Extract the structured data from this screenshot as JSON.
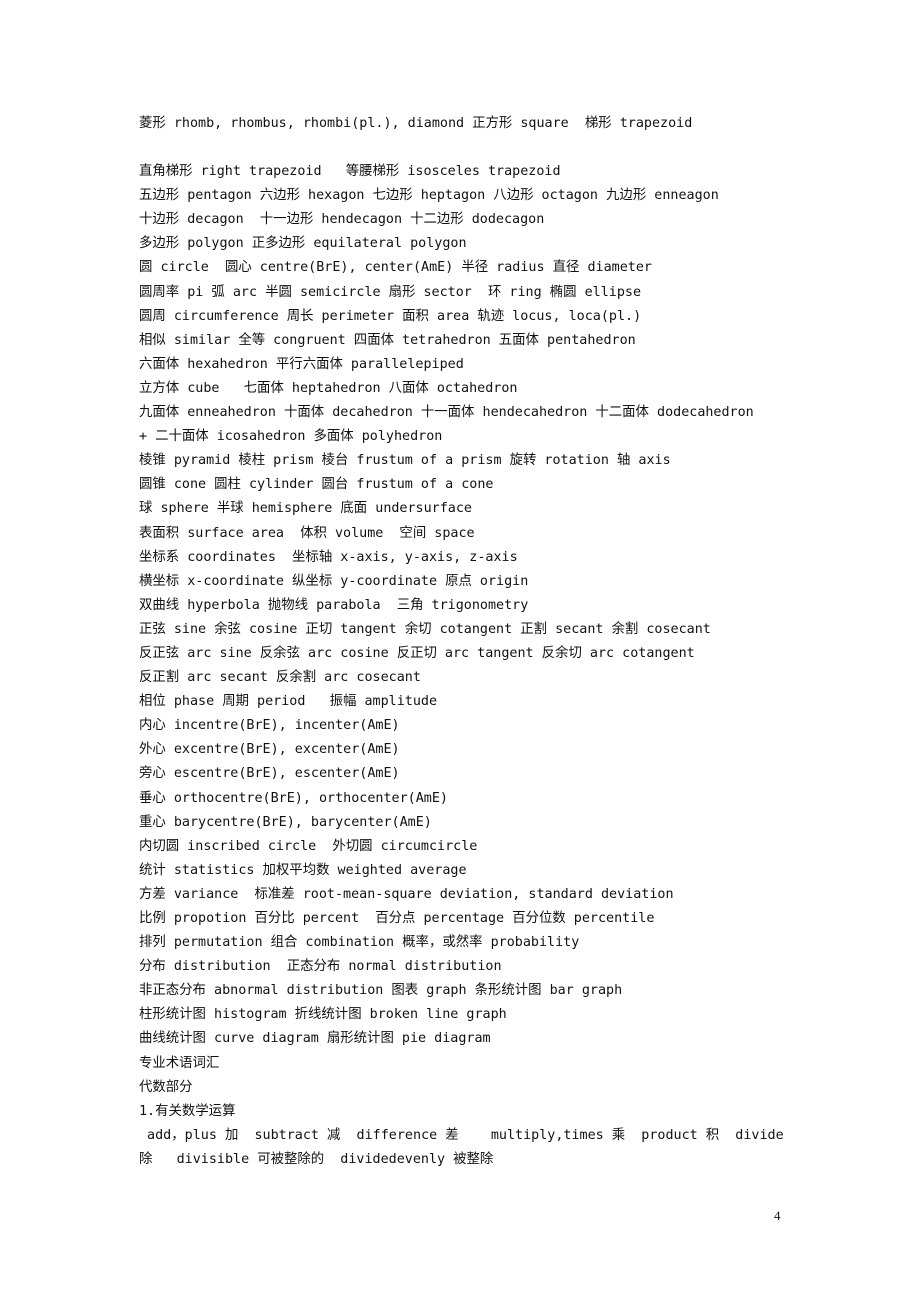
{
  "document": {
    "lines": [
      "菱形 rhomb, rhombus, rhombi(pl.), diamond 正方形 square  梯形 trapezoid",
      "",
      "直角梯形 right trapezoid   等腰梯形 isosceles trapezoid",
      "五边形 pentagon 六边形 hexagon 七边形 heptagon 八边形 octagon 九边形 enneagon",
      "十边形 decagon  十一边形 hendecagon 十二边形 dodecagon",
      "多边形 polygon 正多边形 equilateral polygon",
      "圆 circle  圆心 centre(BrE), center(AmE) 半径 radius 直径 diameter",
      "圆周率 pi 弧 arc 半圆 semicircle 扇形 sector  环 ring 椭圆 ellipse",
      "圆周 circumference 周长 perimeter 面积 area 轨迹 locus, loca(pl.)",
      "相似 similar 全等 congruent 四面体 tetrahedron 五面体 pentahedron",
      "六面体 hexahedron 平行六面体 parallelepiped",
      "立方体 cube   七面体 heptahedron 八面体 octahedron",
      "九面体 enneahedron 十面体 decahedron 十一面体 hendecahedron 十二面体 dodecahedron",
      "+ 二十面体 icosahedron 多面体 polyhedron",
      "棱锥 pyramid 棱柱 prism 棱台 frustum of a prism 旋转 rotation 轴 axis",
      "圆锥 cone 圆柱 cylinder 圆台 frustum of a cone",
      "球 sphere 半球 hemisphere 底面 undersurface",
      "表面积 surface area  体积 volume  空间 space",
      "坐标系 coordinates  坐标轴 x-axis, y-axis, z-axis",
      "横坐标 x-coordinate 纵坐标 y-coordinate 原点 origin",
      "双曲线 hyperbola 抛物线 parabola  三角 trigonometry",
      "正弦 sine 余弦 cosine 正切 tangent 余切 cotangent 正割 secant 余割 cosecant",
      "反正弦 arc sine 反余弦 arc cosine 反正切 arc tangent 反余切 arc cotangent",
      "反正割 arc secant 反余割 arc cosecant",
      "相位 phase 周期 period   振幅 amplitude",
      "内心 incentre(BrE), incenter(AmE)",
      "外心 excentre(BrE), excenter(AmE)",
      "旁心 escentre(BrE), escenter(AmE)",
      "垂心 orthocentre(BrE), orthocenter(AmE)",
      "重心 barycentre(BrE), barycenter(AmE)",
      "内切圆 inscribed circle  外切圆 circumcircle",
      "统计 statistics 加权平均数 weighted average",
      "方差 variance  标准差 root-mean-square deviation, standard deviation",
      "比例 propotion 百分比 percent  百分点 percentage 百分位数 percentile",
      "排列 permutation 组合 combination 概率，或然率 probability",
      "分布 distribution  正态分布 normal distribution",
      "非正态分布 abnormal distribution 图表 graph 条形统计图 bar graph",
      "柱形统计图 histogram 折线统计图 broken line graph",
      "曲线统计图 curve diagram 扇形统计图 pie diagram",
      "专业术语词汇",
      "代数部分",
      "1.有关数学运算",
      " add，plus 加  subtract 减  difference 差    multiply,times 乘  product 积  divide",
      "除   divisible 可被整除的  dividedevenly 被整除"
    ],
    "page_number": "4"
  }
}
